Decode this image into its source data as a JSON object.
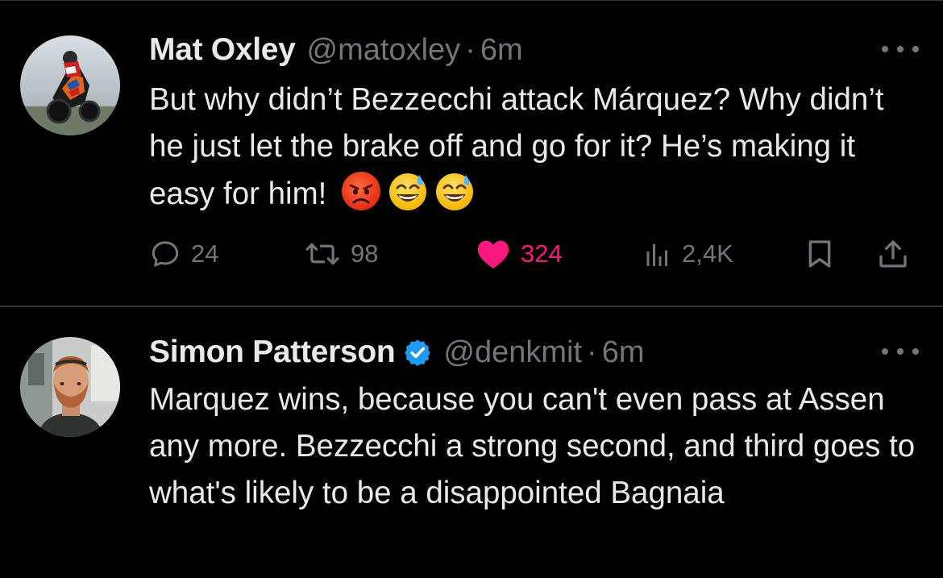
{
  "tweets": [
    {
      "author": {
        "name": "Mat Oxley",
        "handle": "@matoxley",
        "verified": false,
        "avatar": "motorcycle-rider-photo"
      },
      "separator": "·",
      "time": "6m",
      "text": "But why didn’t Bezzecchi attack Márquez? Why didn’t he just let the brake off and go for it? He’s making it easy for him!",
      "emojis": [
        "angry-face-emoji",
        "grinning-sweat-emoji",
        "grinning-sweat-emoji"
      ],
      "stats": {
        "replies": "24",
        "reposts": "98",
        "likes": "324",
        "views": "2,4K"
      },
      "liked": true,
      "colors": {
        "like": "#f91880",
        "muted": "#71767b"
      }
    },
    {
      "author": {
        "name": "Simon Patterson",
        "handle": "@denkmit",
        "verified": true,
        "avatar": "bearded-man-photo"
      },
      "separator": "·",
      "time": "6m",
      "text": "Marquez wins, because you can't even pass at Assen any more. Bezzecchi a strong second, and third goes to what's likely to be a disappointed Bagnaia"
    }
  ],
  "colors": {
    "background": "#000000",
    "text": "#e7e9ea",
    "muted": "#71767b",
    "divider": "#2f3336",
    "verified": "#1d9bf0"
  }
}
